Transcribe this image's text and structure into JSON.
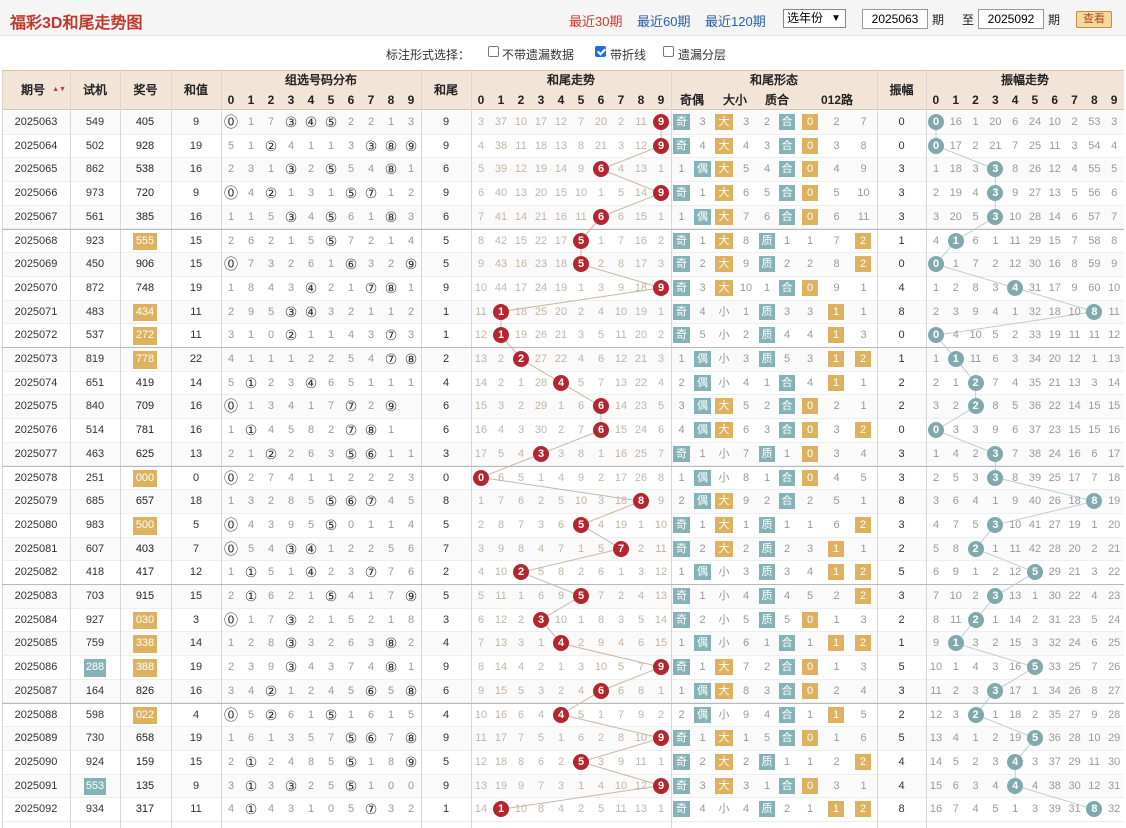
{
  "header": {
    "title": "福彩3D和尾走势图",
    "nav": [
      "最近30期",
      "最近60期",
      "最近120期"
    ],
    "year_select": "选年份",
    "from_value": "2025063",
    "qi1": "期",
    "to_label": "至",
    "to_value": "2025092",
    "qi2": "期",
    "query": "查看"
  },
  "options": {
    "label": "标注形式选择：",
    "items": [
      {
        "label": "不带遗漏数据",
        "checked": false
      },
      {
        "label": "带折线",
        "checked": true
      },
      {
        "label": "遗漏分层",
        "checked": false
      }
    ]
  },
  "columns": {
    "period": "期号",
    "sort_arrows": "▲▼",
    "trial": "试机",
    "prize": "奖号",
    "sum": "和值",
    "dist": "组选号码分布",
    "tail": "和尾",
    "tailtrend": "和尾走势",
    "form": "和尾形态",
    "form_sub": [
      "奇偶",
      "大小",
      "质合",
      "012路"
    ],
    "amp": "振幅",
    "amptrend": "振幅走势",
    "digits": [
      "0",
      "1",
      "2",
      "3",
      "4",
      "5",
      "6",
      "7",
      "8",
      "9"
    ]
  },
  "colors": {
    "red_ball": "#b5252e",
    "teal_ball": "#7fa9ad",
    "orange_tag": "#deb15e",
    "teal_tag": "#85b2b7"
  },
  "rows": [
    {
      "p": "2025063",
      "t": "549",
      "z": "405",
      "s": "9",
      "d": "⓪17③④⑤2213",
      "h": "9",
      "tr": "3 37 10 17 12 7 20 2 11 9",
      "o": [
        "奇",
        "3",
        "大",
        "3",
        "2",
        "合",
        "0",
        "2",
        "7"
      ],
      "a": "0",
      "at": "0 16 1 20 6 24 10 2 53 3"
    },
    {
      "p": "2025064",
      "t": "502",
      "z": "928",
      "s": "19",
      "d": "51②4113③⑧⑨",
      "h": "9",
      "tr": "4 38 11 18 13 8 21 3 12 9",
      "o": [
        "奇",
        "4",
        "大",
        "4",
        "3",
        "合",
        "0",
        "3",
        "8"
      ],
      "a": "0",
      "at": "0 17 2 21 7 25 11 3 54 4"
    },
    {
      "p": "2025065",
      "t": "862",
      "z": "538",
      "s": "16",
      "d": "231③2⑤54⑧1",
      "h": "6",
      "tr": "5 39 12 19 14 9 6 4 13 1",
      "o": [
        "1",
        "偶",
        "大",
        "5",
        "4",
        "合",
        "0",
        "4",
        "9"
      ],
      "a": "3",
      "at": "1 18 3 3 8 26 12 4 55 5"
    },
    {
      "p": "2025066",
      "t": "973",
      "z": "720",
      "s": "9",
      "d": "⓪4②131⑤⑦12",
      "h": "9",
      "tr": "6 40 13 20 15 10 1 5 14 9",
      "o": [
        "奇",
        "1",
        "大",
        "6",
        "5",
        "合",
        "0",
        "5",
        "10"
      ],
      "a": "3",
      "at": "2 19 4 3 9 27 13 5 56 6"
    },
    {
      "p": "2025067",
      "t": "561",
      "z": "385",
      "s": "16",
      "d": "115③4⑤61⑧3",
      "h": "6",
      "tr": "7 41 14 21 16 11 6 6 15 1",
      "o": [
        "1",
        "偶",
        "大",
        "7",
        "6",
        "合",
        "0",
        "6",
        "11"
      ],
      "a": "3",
      "at": "3 20 5 3 10 28 14 6 57 7"
    },
    {
      "p": "2025068",
      "t": "923",
      "z": "555",
      "s": "15",
      "d": "26215⑤7214",
      "h": "5",
      "tr": "8 42 15 22 17 5 1 7 16 2",
      "o": [
        "奇",
        "1",
        "大",
        "8",
        "质",
        "1",
        "1",
        "7",
        "2"
      ],
      "a": "1",
      "at": "4 1 6 1 11 29 15 7 58 8"
    },
    {
      "p": "2025069",
      "t": "450",
      "z": "906",
      "s": "15",
      "d": "⓪73261⑥32⑨",
      "h": "5",
      "tr": "9 43 16 23 18 5 2 8 17 3",
      "o": [
        "奇",
        "2",
        "大",
        "9",
        "质",
        "2",
        "2",
        "8",
        "2"
      ],
      "a": "0",
      "at": "0 1 7 2 12 30 16 8 59 9"
    },
    {
      "p": "2025070",
      "t": "872",
      "z": "748",
      "s": "19",
      "d": "1843④21⑦⑧1",
      "h": "9",
      "tr": "10 44 17 24 19 1 3 9 18 9",
      "o": [
        "奇",
        "3",
        "大",
        "10",
        "1",
        "合",
        "0",
        "9",
        "1"
      ],
      "a": "4",
      "at": "1 2 8 3 4 31 17 9 60 10"
    },
    {
      "p": "2025071",
      "t": "483",
      "z": "434",
      "s": "11",
      "d": "295③④32112",
      "h": "1",
      "tr": "11 1 18 25 20 2 4 10 19 1",
      "o": [
        "奇",
        "4",
        "小",
        "1",
        "质",
        "3",
        "3",
        "1",
        "1"
      ],
      "a": "8",
      "at": "2 3 9 4 1 32 18 10 8 11"
    },
    {
      "p": "2025072",
      "t": "537",
      "z": "272",
      "s": "11",
      "d": "310②1143⑦32",
      "h": "1",
      "tr": "12 1 19 26 21 3 5 11 20 2",
      "o": [
        "奇",
        "5",
        "小",
        "2",
        "质",
        "4",
        "4",
        "1",
        "3"
      ],
      "a": "0",
      "at": "0 4 10 5 2 33 19 11 11 12"
    },
    {
      "p": "2025073",
      "t": "819",
      "z": "778",
      "s": "22",
      "d": "41112254⑦⑧4",
      "h": "2",
      "tr": "13 2 2 27 22 4 6 12 21 3",
      "o": [
        "1",
        "偶",
        "小",
        "3",
        "质",
        "5",
        "3",
        "1",
        "2"
      ],
      "a": "1",
      "at": "1 1 11 6 3 34 20 12 1 13"
    },
    {
      "p": "2025074",
      "t": "651",
      "z": "419",
      "s": "14",
      "d": "5①23④65111⑨",
      "h": "4",
      "tr": "14 2 1 28 4 5 7 13 22 4",
      "o": [
        "2",
        "偶",
        "小",
        "4",
        "1",
        "合",
        "4",
        "1",
        "1"
      ],
      "a": "2",
      "at": "2 1 2 7 4 35 21 13 3 14"
    },
    {
      "p": "2025075",
      "t": "840",
      "z": "709",
      "s": "16",
      "d": "⓪13417⑦2⑨",
      "h": "6",
      "tr": "15 3 2 29 1 6 6 14 23 5",
      "o": [
        "3",
        "偶",
        "大",
        "5",
        "2",
        "合",
        "0",
        "2",
        "1"
      ],
      "a": "2",
      "at": "3 2 2 8 5 36 22 14 15 15"
    },
    {
      "p": "2025076",
      "t": "514",
      "z": "781",
      "s": "16",
      "d": "1①4582⑦⑧1",
      "h": "6",
      "tr": "16 4 3 30 2 7 6 15 24 6",
      "o": [
        "4",
        "偶",
        "大",
        "6",
        "3",
        "合",
        "0",
        "3",
        "2"
      ],
      "a": "0",
      "at": "0 3 3 9 6 37 23 15 15 16"
    },
    {
      "p": "2025077",
      "t": "463",
      "z": "625",
      "s": "13",
      "d": "21②263⑤⑥112",
      "h": "3",
      "tr": "17 5 4 3 3 8 1 16 25 7",
      "o": [
        "奇",
        "1",
        "小",
        "7",
        "质",
        "1",
        "0",
        "3",
        "4"
      ],
      "a": "3",
      "at": "1 4 2 3 7 38 24 16 6 17"
    },
    {
      "p": "2025078",
      "t": "251",
      "z": "000",
      "s": "0",
      "d": "⓪2741122 23",
      "h": "0",
      "tr": "0 6 5 1 4 9 2 17 26 8",
      "o": [
        "1",
        "偶",
        "小",
        "8",
        "1",
        "合",
        "0",
        "4",
        "5"
      ],
      "a": "3",
      "at": "2 5 3 3 8 39 25 17 7 18"
    },
    {
      "p": "2025079",
      "t": "685",
      "z": "657",
      "s": "18",
      "d": "13285⑤⑥⑦45",
      "h": "8",
      "tr": "1 7 6 2 5 10 3 18 8 9",
      "o": [
        "2",
        "偶",
        "大",
        "9",
        "2",
        "合",
        "2",
        "5",
        "1"
      ],
      "a": "8",
      "at": "3 6 4 1 9 40 26 18 8 19"
    },
    {
      "p": "2025080",
      "t": "983",
      "z": "500",
      "s": "5",
      "d": "⓪4395⑤01145",
      "h": "5",
      "tr": "2 8 7 3 6 5 4 19 1 10",
      "o": [
        "奇",
        "1",
        "大",
        "1",
        "质",
        "1",
        "1",
        "6",
        "2"
      ],
      "a": "3",
      "at": "4 7 5 3 10 41 27 19 1 20"
    },
    {
      "p": "2025081",
      "t": "607",
      "z": "403",
      "s": "7",
      "d": "⓪54③④12256",
      "h": "7",
      "tr": "3 9 8 4 7 1 5 7 2 11",
      "o": [
        "奇",
        "2",
        "大",
        "2",
        "质",
        "2",
        "3",
        "1",
        "1"
      ],
      "a": "2",
      "at": "5 8 2 1 11 42 28 20 2 21"
    },
    {
      "p": "2025082",
      "t": "418",
      "z": "417",
      "s": "12",
      "d": "1①51④23⑦76",
      "h": "2",
      "tr": "4 10 2 5 8 2 6 1 3 12",
      "o": [
        "1",
        "偶",
        "小",
        "3",
        "质",
        "3",
        "4",
        "1",
        "2"
      ],
      "a": "5",
      "at": "6 9 1 2 12 5 29 21 3 22"
    },
    {
      "p": "2025083",
      "t": "703",
      "z": "915",
      "s": "15",
      "d": "2①621⑤417⑨",
      "h": "5",
      "tr": "5 11 1 6 9 5 7 2 4 13",
      "o": [
        "奇",
        "1",
        "小",
        "4",
        "质",
        "4",
        "5",
        "2",
        "2"
      ],
      "a": "3",
      "at": "7 10 2 3 13 1 30 22 4 23"
    },
    {
      "p": "2025084",
      "t": "927",
      "z": "030",
      "s": "3",
      "d": "⓪17③215218",
      "h": "3",
      "tr": "6 12 2 3 10 1 8 3 5 14",
      "o": [
        "奇",
        "2",
        "小",
        "5",
        "质",
        "5",
        "0",
        "1",
        "3"
      ],
      "a": "2",
      "at": "8 11 2 1 14 2 31 23 5 24"
    },
    {
      "p": "2025085",
      "t": "759",
      "z": "338",
      "s": "14",
      "d": "128③3263⑧2",
      "h": "4",
      "tr": "7 13 3 1 4 2 9 4 6 15",
      "o": [
        "1",
        "偶",
        "小",
        "6",
        "1",
        "合",
        "1",
        "1",
        "2"
      ],
      "a": "1",
      "at": "9 1 3 2 15 3 32 24 6 25"
    },
    {
      "p": "2025086",
      "t": "288",
      "z": "388",
      "s": "19",
      "d": "239③4374⑧1",
      "h": "9",
      "tr": "8 14 4 2 1 3 10 5 7 9",
      "o": [
        "奇",
        "1",
        "大",
        "7",
        "2",
        "合",
        "0",
        "1",
        "3"
      ],
      "a": "5",
      "at": "10 1 4 3 16 5 33 25 7 26"
    },
    {
      "p": "2025087",
      "t": "164",
      "z": "826",
      "s": "16",
      "d": "34②1245⑥5⑧4",
      "h": "6",
      "tr": "9 15 5 3 2 4 6 6 8 1",
      "o": [
        "1",
        "偶",
        "大",
        "8",
        "3",
        "合",
        "0",
        "2",
        "4"
      ],
      "a": "3",
      "at": "11 2 3 3 17 1 34 26 8 27"
    },
    {
      "p": "2025088",
      "t": "598",
      "z": "022",
      "s": "4",
      "d": "⓪5②61⑤1615",
      "h": "4",
      "tr": "10 16 6 4 4 5 1 7 9 2",
      "o": [
        "2",
        "偶",
        "小",
        "9",
        "4",
        "合",
        "1",
        "1",
        "5"
      ],
      "a": "2",
      "at": "12 3 2 1 18 2 35 27 9 28"
    },
    {
      "p": "2025089",
      "t": "730",
      "z": "658",
      "s": "19",
      "d": "161357⑤⑥7⑧6",
      "h": "9",
      "tr": "11 17 7 5 1 6 2 8 10 9",
      "o": [
        "奇",
        "1",
        "大",
        "1",
        "5",
        "合",
        "0",
        "1",
        "6"
      ],
      "a": "5",
      "at": "13 4 1 2 19 5 36 28 10 29"
    },
    {
      "p": "2025090",
      "t": "924",
      "z": "159",
      "s": "15",
      "d": "2①2485⑤18⑨",
      "h": "5",
      "tr": "12 18 8 6 2 5 3 9 11 1",
      "o": [
        "奇",
        "2",
        "大",
        "2",
        "质",
        "1",
        "1",
        "2",
        "2"
      ],
      "a": "4",
      "at": "14 5 2 3 4 3 37 29 11 30"
    },
    {
      "p": "2025091",
      "t": "553",
      "z": "135",
      "s": "9",
      "d": "3①3③25⑤1002",
      "h": "9",
      "tr": "13 19 9 7 3 1 4 10 12 9",
      "o": [
        "奇",
        "3",
        "大",
        "3",
        "1",
        "合",
        "0",
        "3",
        "1"
      ],
      "a": "4",
      "at": "15 6 3 4 4 4 38 30 12 31"
    },
    {
      "p": "2025092",
      "t": "934",
      "z": "317",
      "s": "11",
      "d": "4①43105⑦32",
      "h": "1",
      "tr": "14 1 10 8 4 2 5 11 13 1",
      "o": [
        "奇",
        "4",
        "小",
        "4",
        "质",
        "2",
        "1",
        "1",
        "2"
      ],
      "a": "8",
      "at": "16 7 4 5 1 3 39 31 8 32"
    }
  ]
}
